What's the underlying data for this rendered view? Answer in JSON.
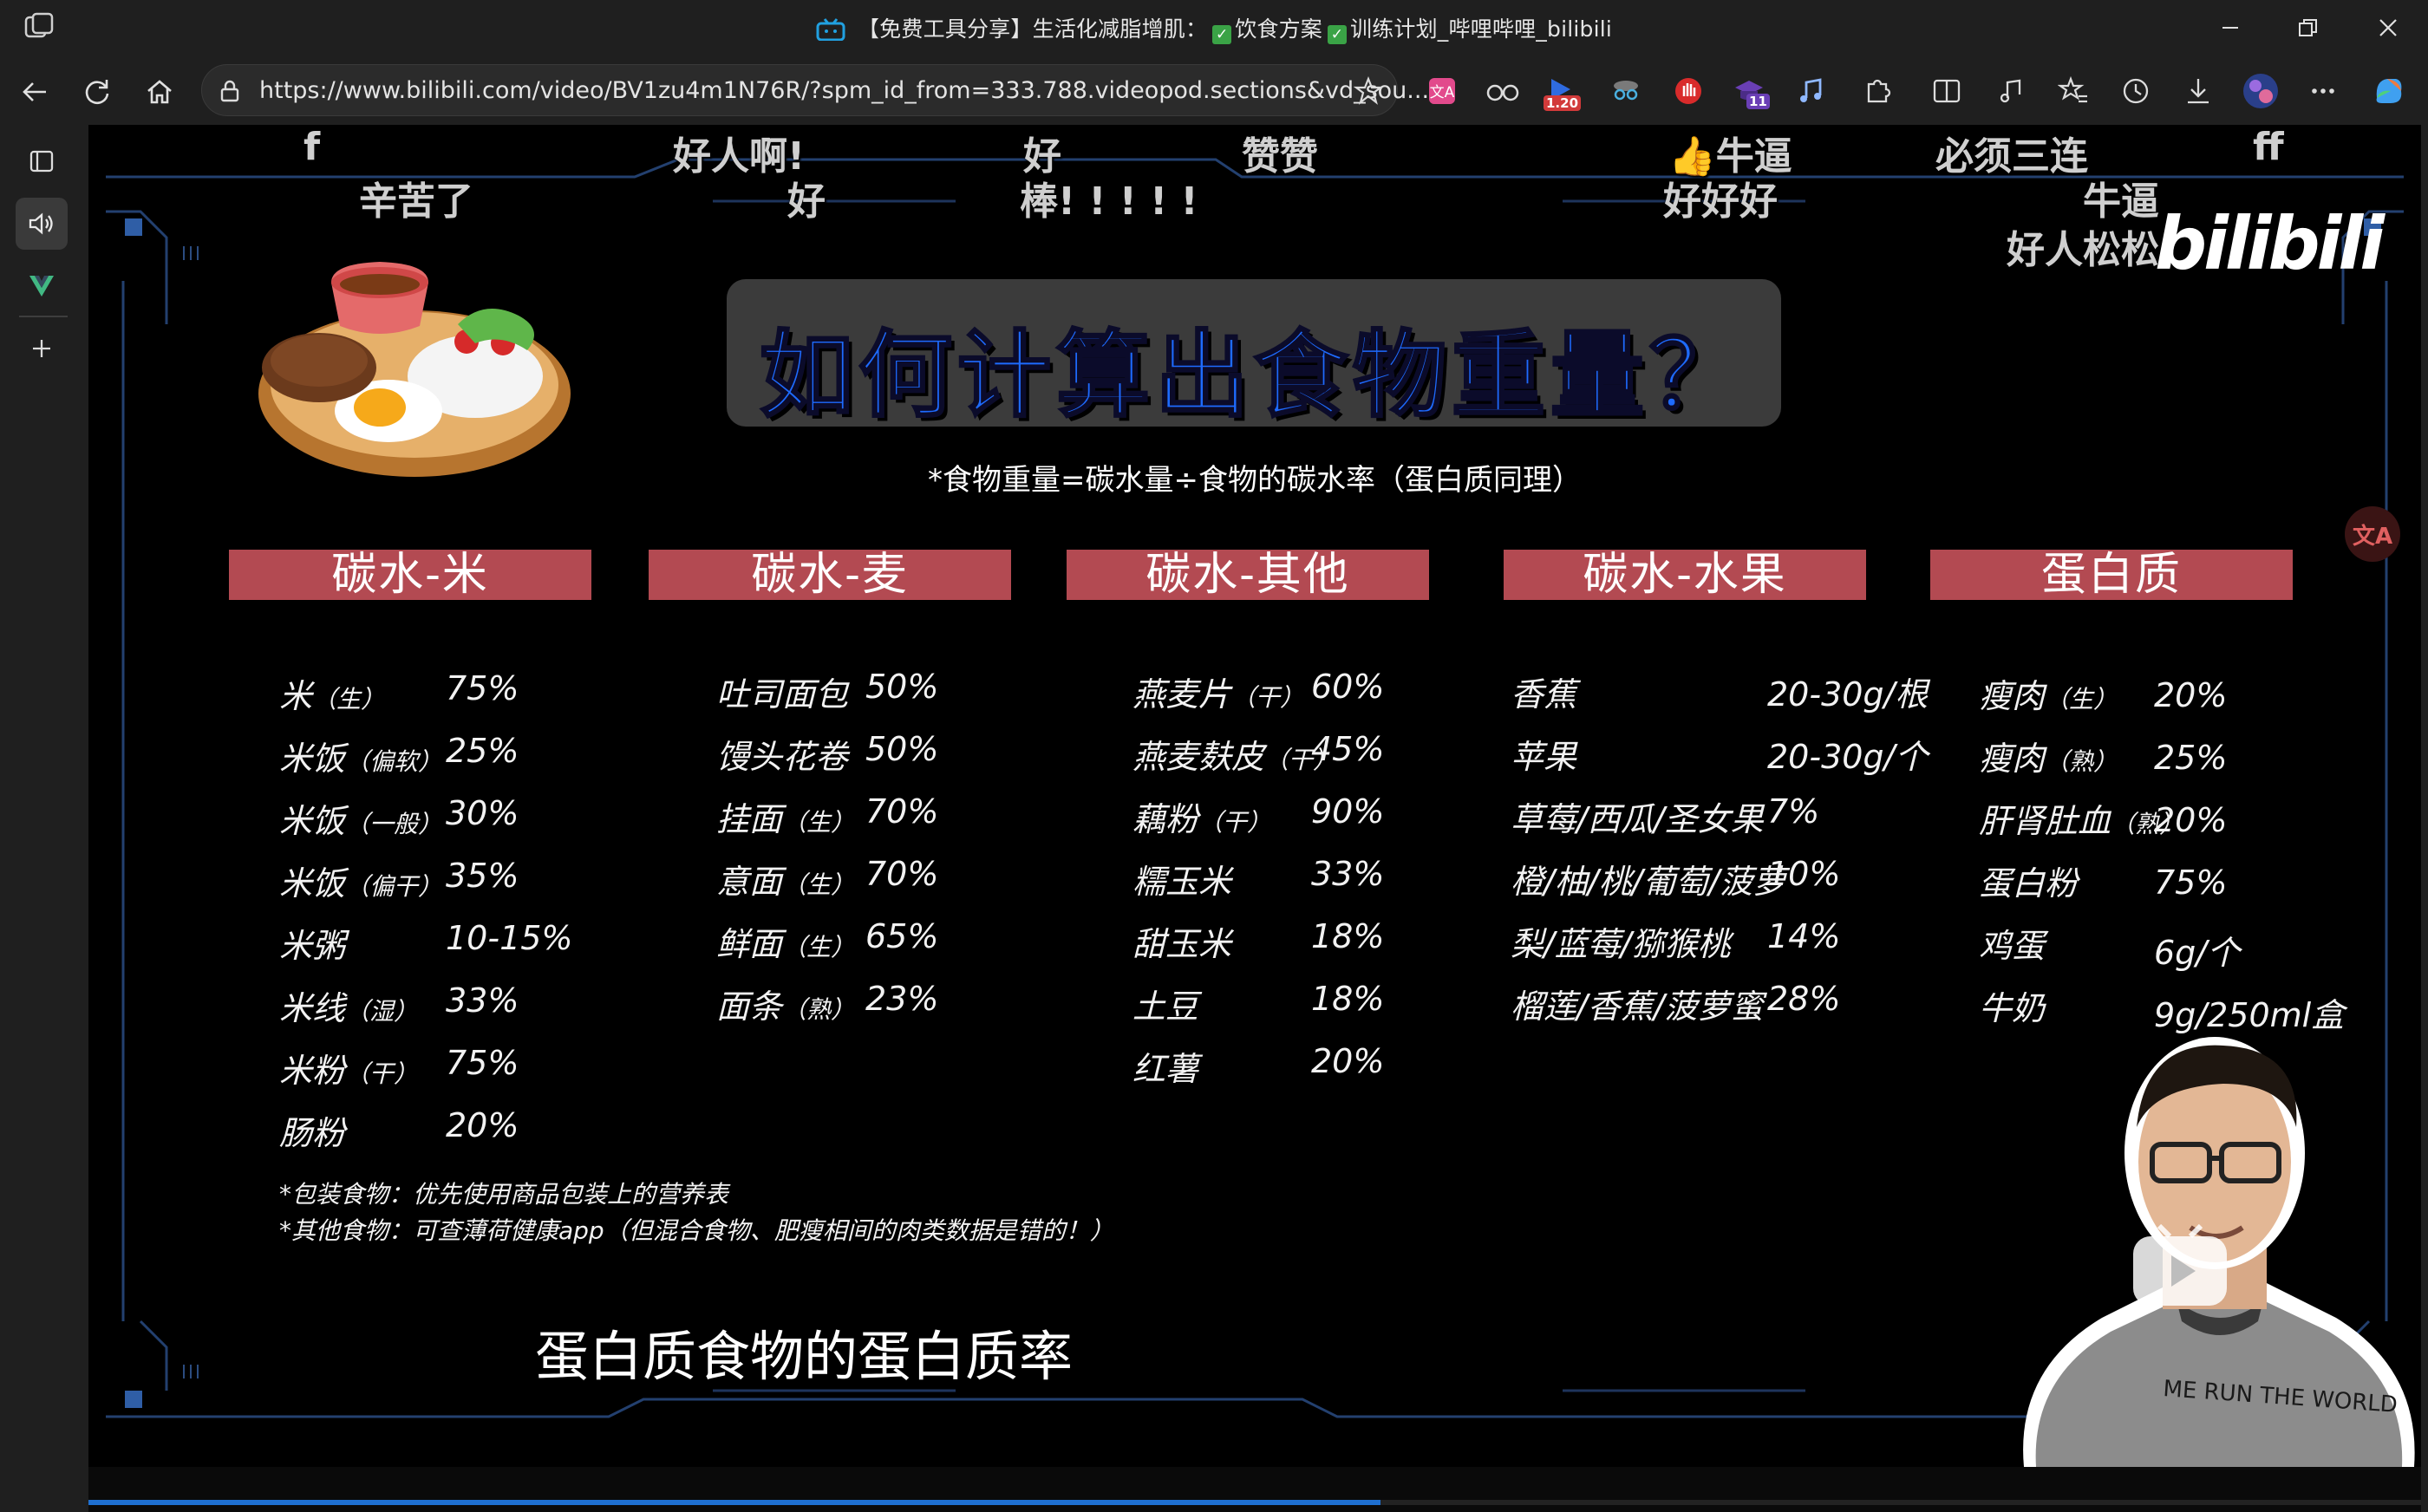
{
  "window": {
    "title_prefix": "【免费工具分享】生活化减脂增肌：",
    "title_part2": "饮食方案",
    "title_part3": "训练计划_哔哩哔哩_bilibili",
    "check_glyph": "✓"
  },
  "toolbar": {
    "url": "https://www.bilibili.com/video/BV1zu4m1N76R/?spm_id_from=333.788.videopod.sections&vd_sou...",
    "badge_speed": "1.20",
    "badge_count": "11"
  },
  "danmaku": [
    {
      "text": "f"
    },
    {
      "text": "好人啊!"
    },
    {
      "text": "好"
    },
    {
      "text": "赞赞"
    },
    {
      "text": "牛逼"
    },
    {
      "text": "必须三连"
    },
    {
      "text": "ff"
    },
    {
      "text": "辛苦了"
    },
    {
      "text": "好"
    },
    {
      "text": "棒! ! ! ! !"
    },
    {
      "text": "好好好"
    },
    {
      "text": "牛逼"
    },
    {
      "text": "好人松松"
    }
  ],
  "video": {
    "logo": "bilibili",
    "title": "如何计算出食物重量？",
    "formula": "*食物重量=碳水量÷食物的碳水率（蛋白质同理）",
    "subtitle": "蛋白质食物的蛋白质率",
    "notes": [
      "*包装食物：优先使用商品包装上的营养表",
      "*其他食物：可查薄荷健康app（但混合食物、肥瘦相间的肉类数据是错的！）"
    ],
    "shirt_text": "ME RUN THE WORLD"
  },
  "columns": [
    {
      "header": "碳水-米",
      "rows": [
        {
          "name": "米",
          "tag": "（生）",
          "value": "75%"
        },
        {
          "name": "米饭",
          "tag": "（偏软）",
          "value": "25%"
        },
        {
          "name": "米饭",
          "tag": "（一般）",
          "value": "30%"
        },
        {
          "name": "米饭",
          "tag": "（偏干）",
          "value": "35%"
        },
        {
          "name": "米粥",
          "tag": "",
          "value": "10-15%"
        },
        {
          "name": "米线",
          "tag": "（湿）",
          "value": "33%"
        },
        {
          "name": "米粉",
          "tag": "（干）",
          "value": "75%"
        },
        {
          "name": "肠粉",
          "tag": "",
          "value": "20%"
        }
      ]
    },
    {
      "header": "碳水-麦",
      "rows": [
        {
          "name": "吐司面包",
          "tag": "",
          "value": "50%"
        },
        {
          "name": "馒头花卷",
          "tag": "",
          "value": "50%"
        },
        {
          "name": "挂面",
          "tag": "（生）",
          "value": "70%"
        },
        {
          "name": "意面",
          "tag": "（生）",
          "value": "70%"
        },
        {
          "name": "鲜面",
          "tag": "（生）",
          "value": "65%"
        },
        {
          "name": "面条",
          "tag": "（熟）",
          "value": "23%"
        }
      ]
    },
    {
      "header": "碳水-其他",
      "rows": [
        {
          "name": "燕麦片",
          "tag": "（干）",
          "value": "60%"
        },
        {
          "name": "燕麦麸皮",
          "tag": "（干）",
          "value": "45%"
        },
        {
          "name": "藕粉",
          "tag": "（干）",
          "value": "90%"
        },
        {
          "name": "糯玉米",
          "tag": "",
          "value": "33%"
        },
        {
          "name": "甜玉米",
          "tag": "",
          "value": "18%"
        },
        {
          "name": "土豆",
          "tag": "",
          "value": "18%"
        },
        {
          "name": "红薯",
          "tag": "",
          "value": "20%"
        }
      ]
    },
    {
      "header": "碳水-水果",
      "rows": [
        {
          "name": "香蕉",
          "tag": "",
          "value": "20-30g/根"
        },
        {
          "name": "苹果",
          "tag": "",
          "value": "20-30g/个"
        },
        {
          "name": "草莓/西瓜/圣女果",
          "tag": "",
          "value": "7%"
        },
        {
          "name": "橙/柚/桃/葡萄/菠萝",
          "tag": "",
          "value": "10%"
        },
        {
          "name": "梨/蓝莓/猕猴桃",
          "tag": "",
          "value": "14%"
        },
        {
          "name": "榴莲/香蕉/菠萝蜜",
          "tag": "",
          "value": "28%"
        }
      ]
    },
    {
      "header": "蛋白质",
      "rows": [
        {
          "name": "瘦肉",
          "tag": "（生）",
          "value": "20%"
        },
        {
          "name": "瘦肉",
          "tag": "（熟）",
          "value": "25%"
        },
        {
          "name": "肝肾肚血",
          "tag": "（熟）",
          "value": "20%"
        },
        {
          "name": "蛋白粉",
          "tag": "",
          "value": "75%"
        },
        {
          "name": "鸡蛋",
          "tag": "",
          "value": "6g/个"
        },
        {
          "name": "牛奶",
          "tag": "",
          "value": "9g/250ml盒"
        }
      ]
    }
  ],
  "progress": {
    "fraction": 0.554
  },
  "colors": {
    "header_red": "#b34a52",
    "title_blue": "#1e6bff",
    "frame_blue": "#2a4a8a",
    "progress_blue": "#1e6fd0"
  }
}
